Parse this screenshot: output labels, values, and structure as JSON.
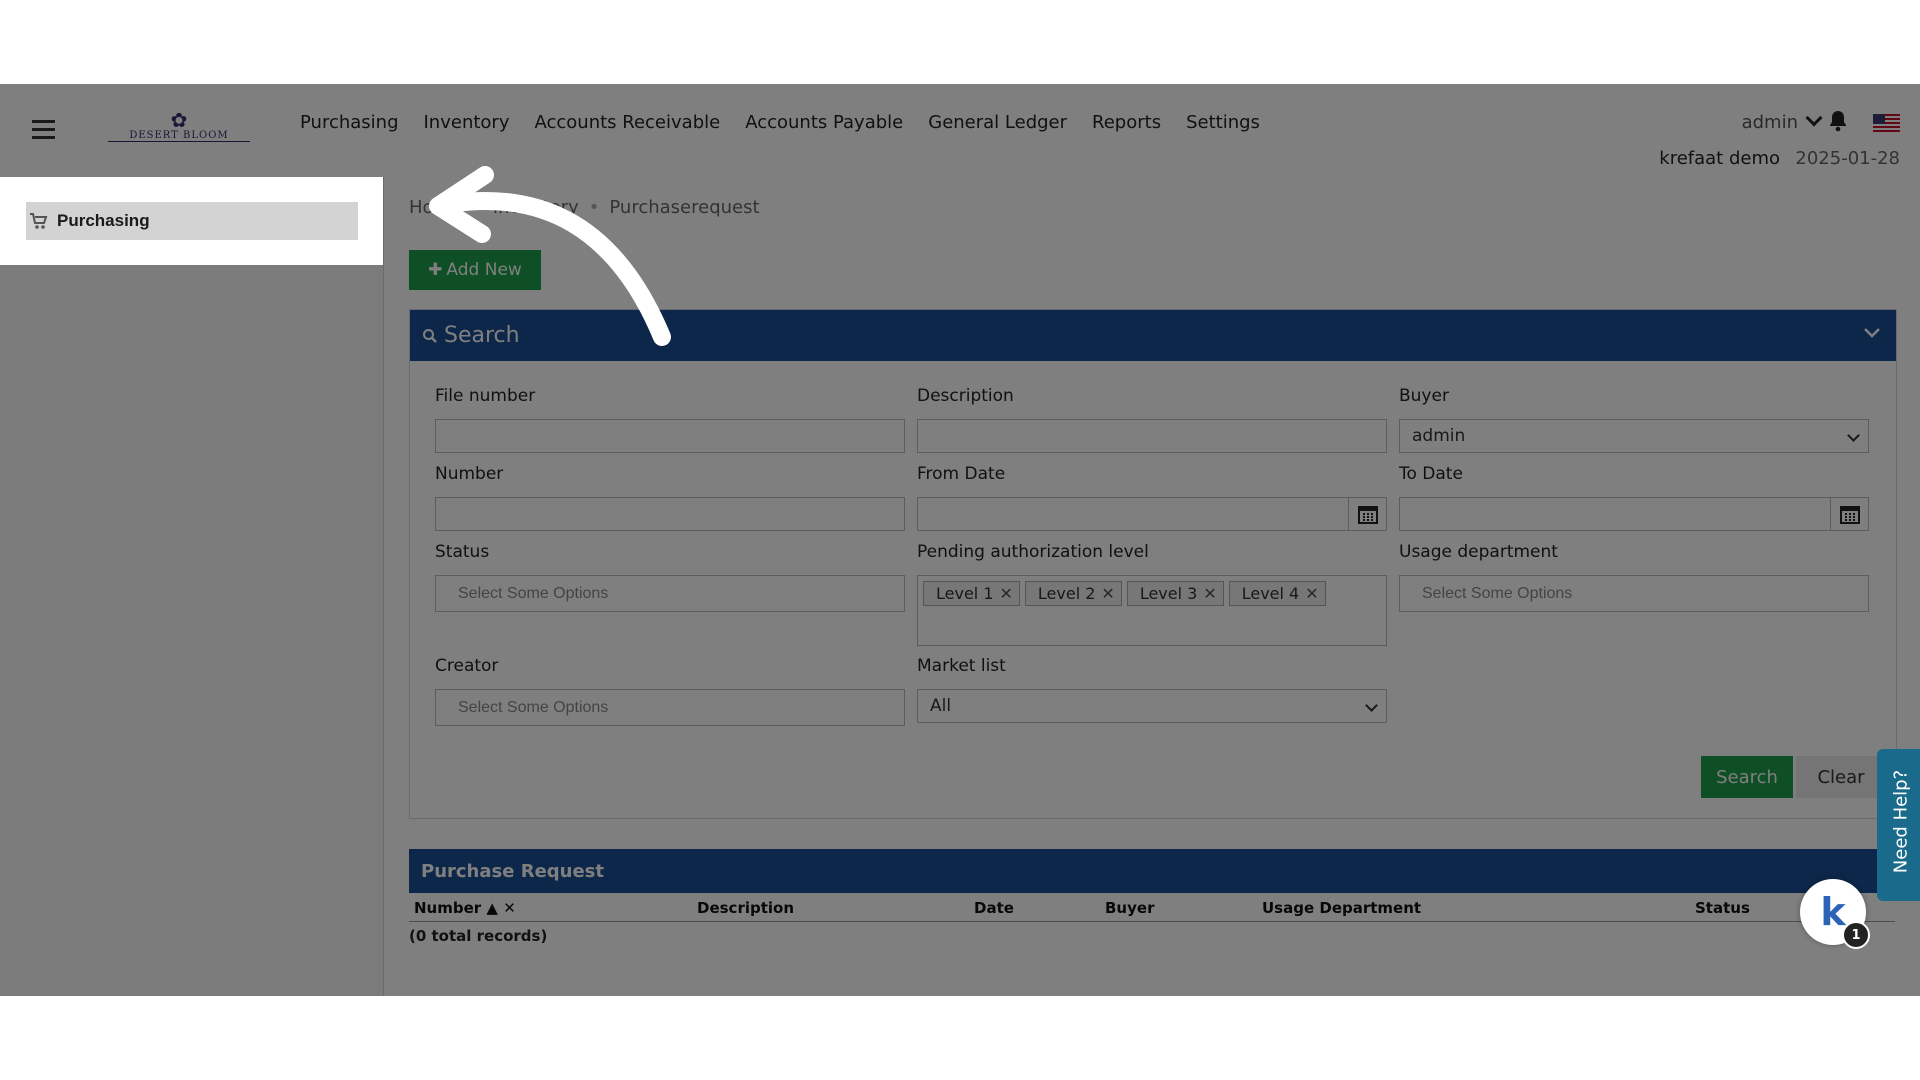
{
  "header": {
    "logo_text": "DESERT BLOOM",
    "nav": [
      "Purchasing",
      "Inventory",
      "Accounts Receivable",
      "Accounts Payable",
      "General Ledger",
      "Reports",
      "Settings"
    ],
    "user": "admin",
    "company": "krefaat demo",
    "date": "2025-01-28"
  },
  "sidebar": {
    "items": [
      {
        "label": "Purchasing"
      }
    ]
  },
  "breadcrumb": [
    "Home",
    "Inventory",
    "Purchaserequest"
  ],
  "add_new_label": "Add New",
  "search": {
    "title": "Search",
    "fields": {
      "file_number": {
        "label": "File number",
        "value": ""
      },
      "description": {
        "label": "Description",
        "value": ""
      },
      "buyer": {
        "label": "Buyer",
        "value": "admin"
      },
      "number": {
        "label": "Number",
        "value": ""
      },
      "from_date": {
        "label": "From Date",
        "value": ""
      },
      "to_date": {
        "label": "To Date",
        "value": ""
      },
      "status": {
        "label": "Status",
        "placeholder": "Select Some Options"
      },
      "pending_authorization_level": {
        "label": "Pending authorization level",
        "tags": [
          "Level 1",
          "Level 2",
          "Level 3",
          "Level 4"
        ]
      },
      "usage_department": {
        "label": "Usage department",
        "placeholder": "Select Some Options"
      },
      "creator": {
        "label": "Creator",
        "placeholder": "Select Some Options"
      },
      "market_list": {
        "label": "Market list",
        "value": "All"
      }
    },
    "search_button": "Search",
    "clear_button": "Clear"
  },
  "purchase_request": {
    "title": "Purchase Request",
    "columns": [
      "Number",
      "Description",
      "Date",
      "Buyer",
      "Usage Department",
      "Status"
    ],
    "records_text": "(0 total records)"
  },
  "help": {
    "label": "Need Help?"
  },
  "chatbot": {
    "letter": "k",
    "badge": "1"
  },
  "colors": {
    "primary_blue": "#1a4f95",
    "green": "#1e9e4a",
    "overlay": "rgba(0,0,0,0.5)"
  }
}
